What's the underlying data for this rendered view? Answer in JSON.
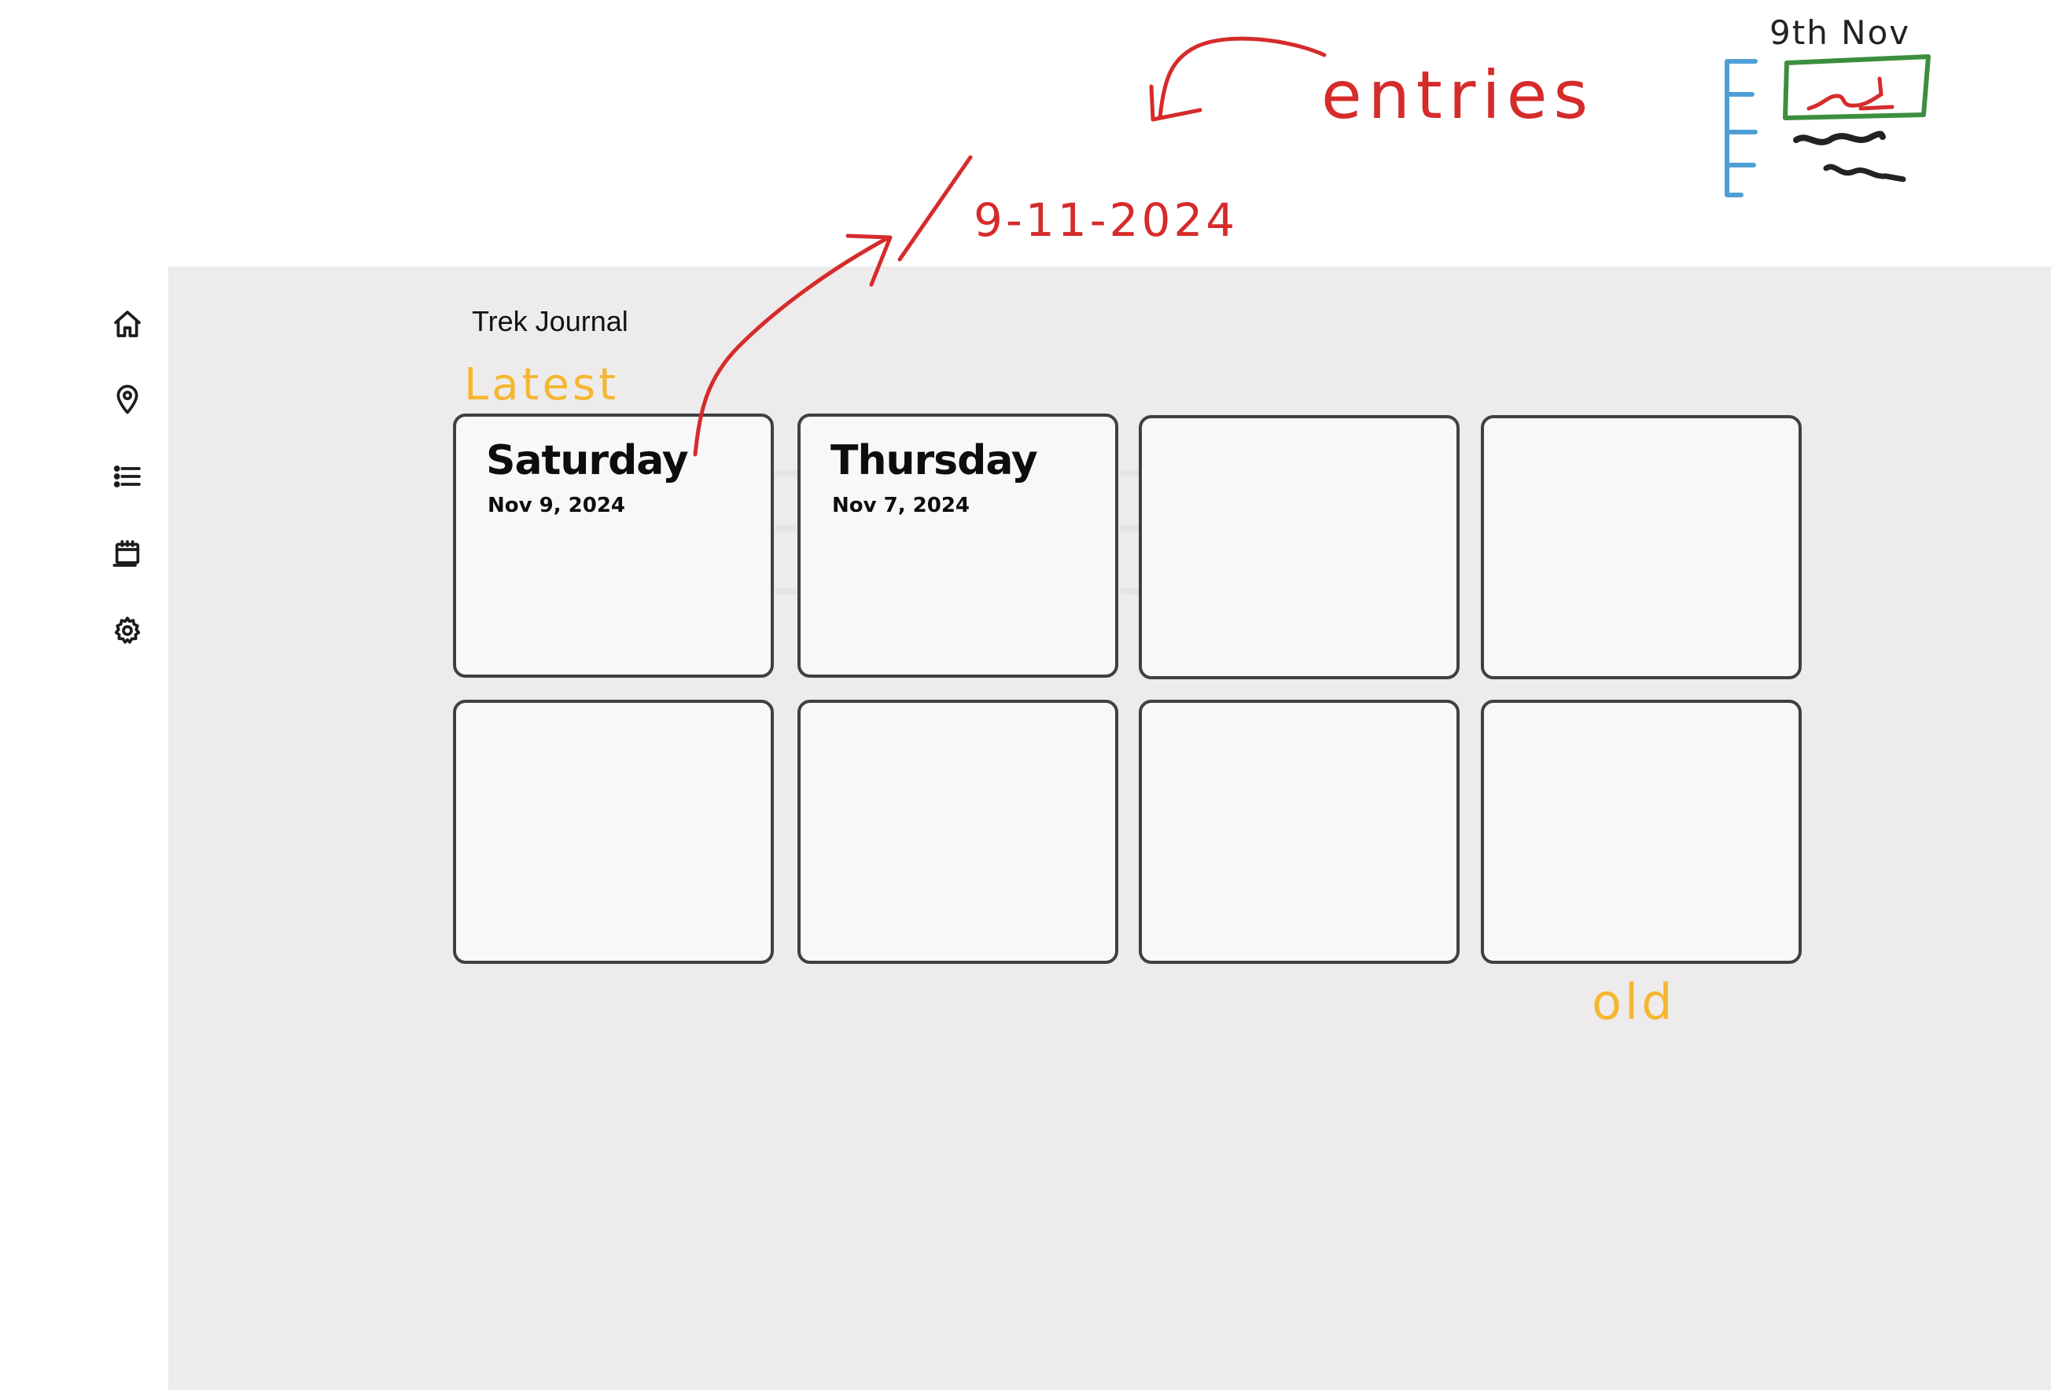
{
  "app": {
    "title": "Trek Journal"
  },
  "sidebar": {
    "items": [
      {
        "icon": "home-icon"
      },
      {
        "icon": "location-pin-icon"
      },
      {
        "icon": "list-icon"
      },
      {
        "icon": "calendar-icon"
      },
      {
        "icon": "gear-icon"
      }
    ]
  },
  "entries": [
    {
      "day": "Saturday",
      "date": "Nov 9, 2024"
    },
    {
      "day": "Thursday",
      "date": "Nov 7, 2024"
    },
    {
      "day": "",
      "date": ""
    },
    {
      "day": "",
      "date": ""
    },
    {
      "day": "",
      "date": ""
    },
    {
      "day": "",
      "date": ""
    },
    {
      "day": "",
      "date": ""
    },
    {
      "day": "",
      "date": ""
    }
  ],
  "annotations": {
    "entries": "entries",
    "date_note": "9-11-2024",
    "latest": "Latest",
    "old": "old",
    "thumb_date": "9th Nov"
  },
  "colors": {
    "background": "#edebeb",
    "card": "#f7f8fa",
    "card_border": "#404040",
    "annotation_red": "#d62b2b",
    "annotation_yellow": "#f5b731",
    "annotation_blue": "#4f9fd6",
    "annotation_green": "#3c8e3f"
  }
}
